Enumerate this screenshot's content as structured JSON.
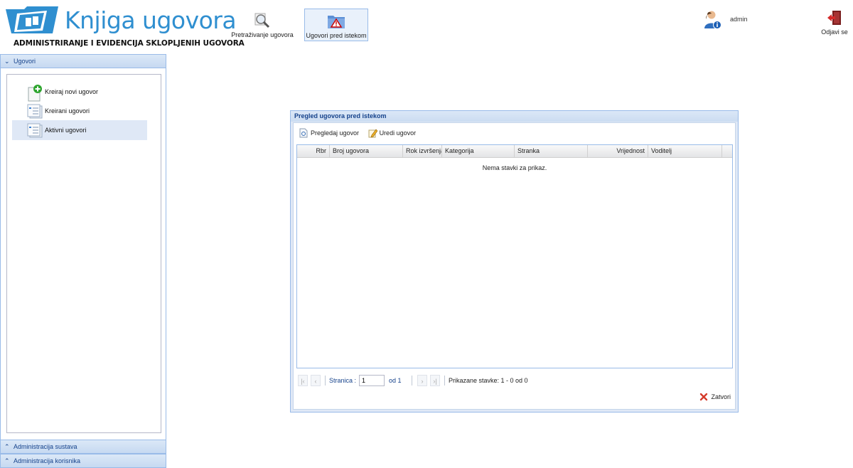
{
  "app": {
    "title": "Knjiga ugovora",
    "subtitle": "ADMINISTRIRANJE I EVIDENCIJA SKLOPLJENIH UGOVORA"
  },
  "toolbar": {
    "search_label": "Pretraživanje ugovora",
    "expiring_label": "Ugovori pred istekom"
  },
  "user": {
    "name": "admin",
    "logout_label": "Odjavi se"
  },
  "sidebar": {
    "sections": [
      {
        "label": "Ugovori"
      },
      {
        "label": "Administracija sustava"
      },
      {
        "label": "Administracija korisnika"
      }
    ],
    "items": [
      {
        "label": "Kreiraj novi ugovor",
        "icon": "document-add-icon"
      },
      {
        "label": "Kreirani ugovori",
        "icon": "document-list-icon"
      },
      {
        "label": "Aktivni ugovori",
        "icon": "document-list-icon",
        "selected": true
      }
    ]
  },
  "dialog": {
    "title": "Pregled ugovora pred istekom",
    "view_label": "Pregledaj ugovor",
    "edit_label": "Uredi ugovor",
    "columns": [
      "Rbr",
      "Broj ugovora",
      "Rok izvršenja",
      "Kategorija",
      "Stranka",
      "Vrijednost",
      "Voditelj"
    ],
    "empty_text": "Nema stavki za prikaz.",
    "pager": {
      "page_label": "Stranica :",
      "page_value": "1",
      "of_label": "od 1",
      "info": "Prikazane stavke: 1 - 0 od 0"
    },
    "close_label": "Zatvori"
  },
  "colors": {
    "accent": "#2f8fd0",
    "panel_border": "#99bbe8",
    "header_text": "#15428b"
  }
}
